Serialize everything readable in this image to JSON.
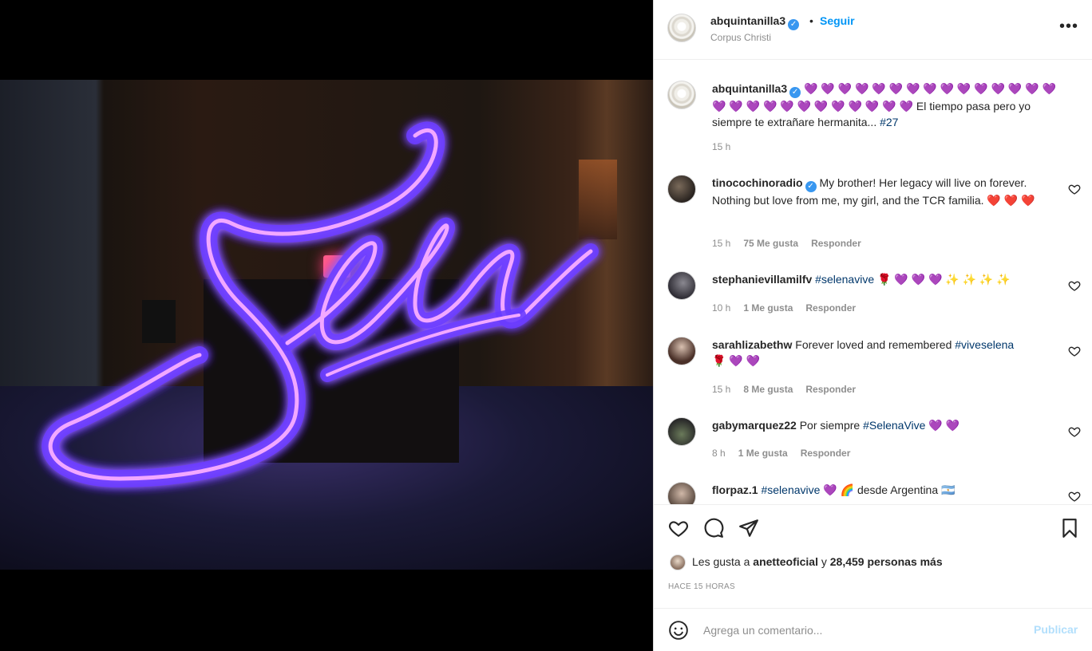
{
  "header": {
    "username": "abquintanilla3",
    "separator": "•",
    "follow_label": "Seguir",
    "location": "Corpus Christi",
    "more_label": "•••"
  },
  "caption": {
    "username": "abquintanilla3",
    "hearts_line": "💜 💜 💜 💜 💜 💜 💜 💜 💜 💜 💜 💜 💜 💜 💜 💜 💜 💜 💜 💜 💜 💜 💜 💜 💜 💜 💜",
    "text": "El tiempo pasa pero yo siempre te extrañare hermanita... ",
    "hashtag": "#27",
    "time": "15 h"
  },
  "comments": [
    {
      "username": "tinocochinoradio",
      "text": "My brother! Her legacy will live on forever. Nothing but love from me, my girl, and the TCR familia. ❤️ ❤️ ❤️",
      "time": "15 h",
      "likes": "75 Me gusta",
      "reply": "Responder"
    },
    {
      "username": "stephanievillamilfv",
      "hashtag": "#selenavive",
      "text": " 🌹 💜 💜 💜 ✨ ✨ ✨ ✨",
      "time": "10 h",
      "likes": "1 Me gusta",
      "reply": "Responder"
    },
    {
      "username": "sarahlizabethw",
      "text": "Forever loved and remembered ",
      "hashtag": "#viveselena",
      "tail": "🌹 💜 💜",
      "time": "15 h",
      "likes": "8 Me gusta",
      "reply": "Responder"
    },
    {
      "username": "gabymarquez22",
      "text": "Por siempre ",
      "hashtag": "#SelenaVive",
      "tail": " 💜 💜",
      "time": "8 h",
      "likes": "1 Me gusta",
      "reply": "Responder"
    },
    {
      "username": "florpaz.1",
      "hashtag": "#selenavive",
      "tail": " 💜 🌈 desde Argentina 🇦🇷"
    }
  ],
  "likes": {
    "prefix": "Les gusta a ",
    "user": "anetteoficial",
    "middle": " y ",
    "count": "28,459 personas más"
  },
  "post_time": "HACE 15 HORAS",
  "comment_input": {
    "placeholder": "Agrega un comentario..."
  },
  "publish_label": "Publicar",
  "photo": {
    "sign_text": "Selena"
  }
}
